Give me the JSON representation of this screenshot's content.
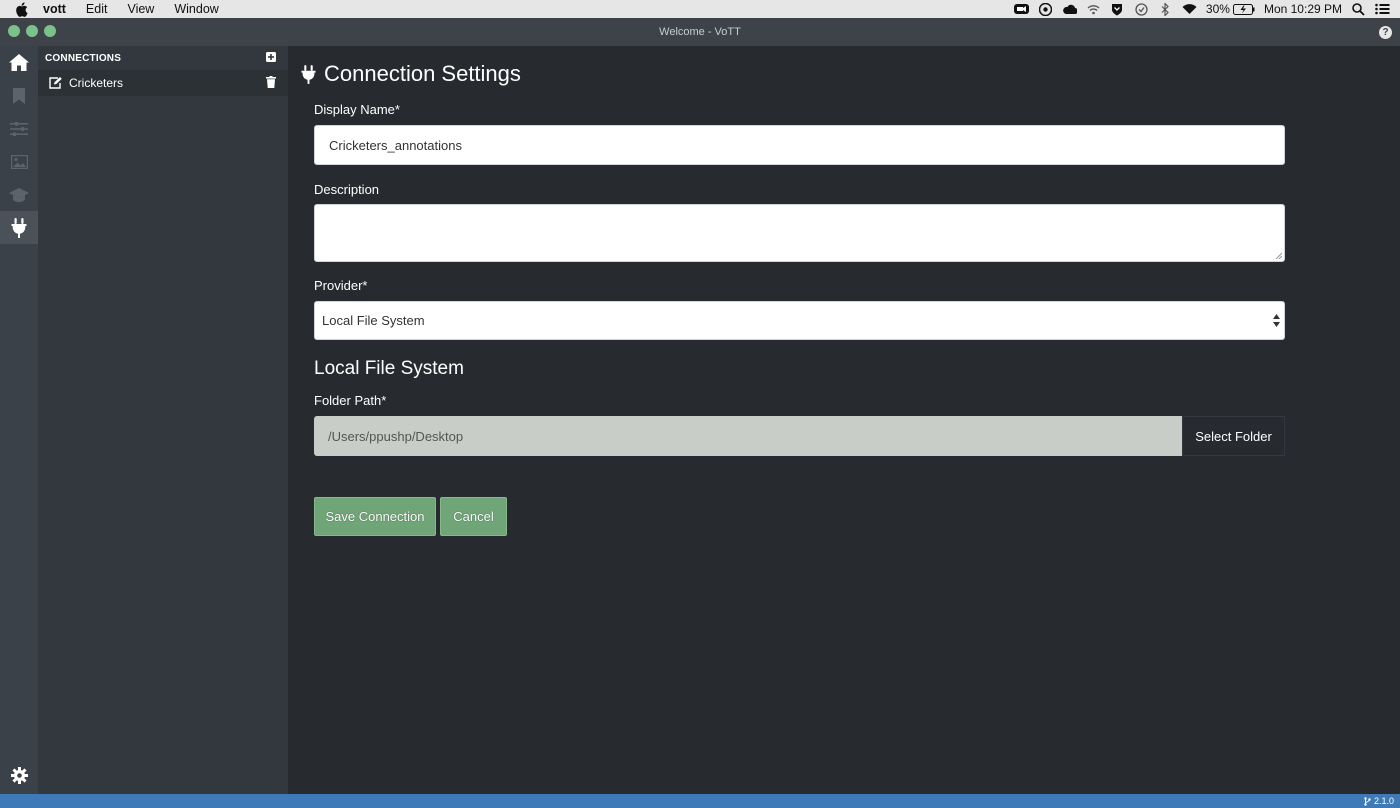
{
  "menubar": {
    "app_name": "vott",
    "items": [
      "Edit",
      "View",
      "Window"
    ],
    "battery": "30%",
    "clock": "Mon 10:29 PM",
    "status_icons": [
      "zoom-icon",
      "chrome-icon",
      "cloud-icon",
      "wifi-alt-icon",
      "shield-icon",
      "sync-icon",
      "bluetooth-icon",
      "wifi-icon"
    ]
  },
  "window": {
    "title": "Welcome - VoTT",
    "help": "?"
  },
  "iconbar": {
    "items": [
      {
        "name": "home",
        "active": false
      },
      {
        "name": "bookmark",
        "active": false
      },
      {
        "name": "sliders",
        "active": false
      },
      {
        "name": "image",
        "active": false
      },
      {
        "name": "graduation-cap",
        "active": false
      },
      {
        "name": "plug",
        "active": true
      }
    ]
  },
  "sidebar": {
    "header": "CONNECTIONS",
    "connections": [
      {
        "label": "Cricketers"
      }
    ]
  },
  "form": {
    "title": "Connection Settings",
    "display_name_label": "Display Name*",
    "display_name_value": "Cricketers_annotations",
    "description_label": "Description",
    "description_value": "",
    "provider_label": "Provider*",
    "provider_value": "Local File System",
    "section_title": "Local File System",
    "folder_path_label": "Folder Path*",
    "folder_path_value": "/Users/ppushp/Desktop",
    "select_folder_label": "Select Folder",
    "save_label": "Save Connection",
    "cancel_label": "Cancel"
  },
  "statusbar": {
    "version": "2.1.0"
  },
  "colors": {
    "accent_button": "#6fa577",
    "statusbar": "#3e7ab8",
    "background": "#272b30",
    "sidebar": "#32383e"
  }
}
